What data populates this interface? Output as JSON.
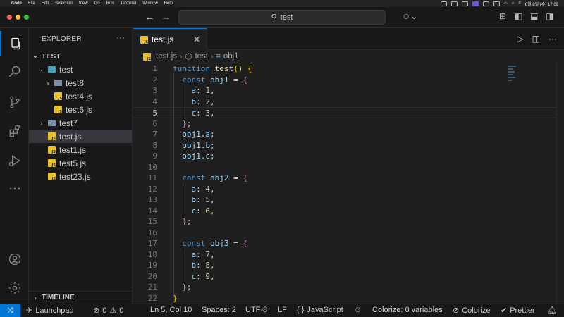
{
  "menubar": {
    "app": "Code",
    "items": [
      "File",
      "Edit",
      "Selection",
      "View",
      "Go",
      "Run",
      "Terminal",
      "Window",
      "Help"
    ],
    "clock": "8월 8일 (수) 17:09"
  },
  "titlebar": {
    "search": "test"
  },
  "activity": [
    "explorer-icon",
    "search-icon",
    "source-control-icon",
    "extensions-icon",
    "run-debug-icon",
    "more-icon",
    "account-icon",
    "settings-gear-icon"
  ],
  "sidebar": {
    "header": "EXPLORER",
    "root": "TEST",
    "tree": [
      {
        "label": "test",
        "kind": "folder-open",
        "depth": 1,
        "chev": "⌄"
      },
      {
        "label": "test8",
        "kind": "folder",
        "depth": 2,
        "chev": "›"
      },
      {
        "label": "test4.js",
        "kind": "js",
        "depth": 2,
        "chev": ""
      },
      {
        "label": "test6.js",
        "kind": "js",
        "depth": 2,
        "chev": ""
      },
      {
        "label": "test7",
        "kind": "folder",
        "depth": 1,
        "chev": "›"
      },
      {
        "label": "test.js",
        "kind": "js",
        "depth": 1,
        "chev": "",
        "selected": true
      },
      {
        "label": "test1.js",
        "kind": "js",
        "depth": 1,
        "chev": ""
      },
      {
        "label": "test5.js",
        "kind": "js",
        "depth": 1,
        "chev": ""
      },
      {
        "label": "test23.js",
        "kind": "js",
        "depth": 1,
        "chev": ""
      }
    ],
    "timeline": "TIMELINE"
  },
  "tab": {
    "label": "test.js"
  },
  "breadcrumb": {
    "file": "test.js",
    "func": "test",
    "symbol": "obj1"
  },
  "editor": {
    "active_line": 5,
    "lines": [
      [
        [
          "kw",
          "function "
        ],
        [
          "fn",
          "test"
        ],
        [
          "br1",
          "() {"
        ]
      ],
      [
        [
          "pl",
          "  "
        ],
        [
          "kw",
          "const "
        ],
        [
          "id",
          "obj1"
        ],
        [
          "pl",
          " = "
        ],
        [
          "br2",
          "{"
        ]
      ],
      [
        [
          "pl",
          "    "
        ],
        [
          "id",
          "a"
        ],
        [
          "pl",
          ": "
        ],
        [
          "num",
          "1"
        ],
        [
          "pl",
          ","
        ]
      ],
      [
        [
          "pl",
          "    "
        ],
        [
          "id",
          "b"
        ],
        [
          "pl",
          ": "
        ],
        [
          "num",
          "2"
        ],
        [
          "pl",
          ","
        ]
      ],
      [
        [
          "pl",
          "    "
        ],
        [
          "id",
          "c"
        ],
        [
          "pl",
          ": "
        ],
        [
          "num",
          "3"
        ],
        [
          "pl",
          ","
        ]
      ],
      [
        [
          "pl",
          "  "
        ],
        [
          "br2",
          "}"
        ],
        [
          "pl",
          ";"
        ]
      ],
      [
        [
          "pl",
          "  "
        ],
        [
          "id",
          "obj1"
        ],
        [
          "pl",
          "."
        ],
        [
          "id",
          "a"
        ],
        [
          "pl",
          ";"
        ]
      ],
      [
        [
          "pl",
          "  "
        ],
        [
          "id",
          "obj1"
        ],
        [
          "pl",
          "."
        ],
        [
          "id",
          "b"
        ],
        [
          "pl",
          ";"
        ]
      ],
      [
        [
          "pl",
          "  "
        ],
        [
          "id",
          "obj1"
        ],
        [
          "pl",
          "."
        ],
        [
          "id",
          "c"
        ],
        [
          "pl",
          ";"
        ]
      ],
      [],
      [
        [
          "pl",
          "  "
        ],
        [
          "kw",
          "const "
        ],
        [
          "id",
          "obj2"
        ],
        [
          "pl",
          " = "
        ],
        [
          "br2",
          "{"
        ]
      ],
      [
        [
          "pl",
          "    "
        ],
        [
          "id",
          "a"
        ],
        [
          "pl",
          ": "
        ],
        [
          "num",
          "4"
        ],
        [
          "pl",
          ","
        ]
      ],
      [
        [
          "pl",
          "    "
        ],
        [
          "id",
          "b"
        ],
        [
          "pl",
          ": "
        ],
        [
          "num",
          "5"
        ],
        [
          "pl",
          ","
        ]
      ],
      [
        [
          "pl",
          "    "
        ],
        [
          "id",
          "c"
        ],
        [
          "pl",
          ": "
        ],
        [
          "num",
          "6"
        ],
        [
          "pl",
          ","
        ]
      ],
      [
        [
          "pl",
          "  "
        ],
        [
          "br2",
          "}"
        ],
        [
          "pl",
          ";"
        ]
      ],
      [],
      [
        [
          "pl",
          "  "
        ],
        [
          "kw",
          "const "
        ],
        [
          "id",
          "obj3"
        ],
        [
          "pl",
          " = "
        ],
        [
          "br2",
          "{"
        ]
      ],
      [
        [
          "pl",
          "    "
        ],
        [
          "id",
          "a"
        ],
        [
          "pl",
          ": "
        ],
        [
          "num",
          "7"
        ],
        [
          "pl",
          ","
        ]
      ],
      [
        [
          "pl",
          "    "
        ],
        [
          "id",
          "b"
        ],
        [
          "pl",
          ": "
        ],
        [
          "num",
          "8"
        ],
        [
          "pl",
          ","
        ]
      ],
      [
        [
          "pl",
          "    "
        ],
        [
          "id",
          "c"
        ],
        [
          "pl",
          ": "
        ],
        [
          "num",
          "9"
        ],
        [
          "pl",
          ","
        ]
      ],
      [
        [
          "pl",
          "  "
        ],
        [
          "br2",
          "}"
        ],
        [
          "pl",
          ";"
        ]
      ],
      [
        [
          "br1",
          "}"
        ]
      ]
    ]
  },
  "status": {
    "launchpad": "Launchpad",
    "errors": "0",
    "warnings": "0",
    "position": "Ln 5, Col 10",
    "spaces": "Spaces: 2",
    "encoding": "UTF-8",
    "eol": "LF",
    "language": "JavaScript",
    "colorize_vars": "Colorize: 0 variables",
    "colorize": "Colorize",
    "prettier": "Prettier"
  },
  "colors": {
    "accent": "#0078d4",
    "keyword": "#569cd6",
    "function": "#dcdcaa",
    "variable": "#9cdcfe",
    "number": "#b5cea8",
    "bracket1": "#ffd700",
    "bracket2": "#da70d6"
  }
}
